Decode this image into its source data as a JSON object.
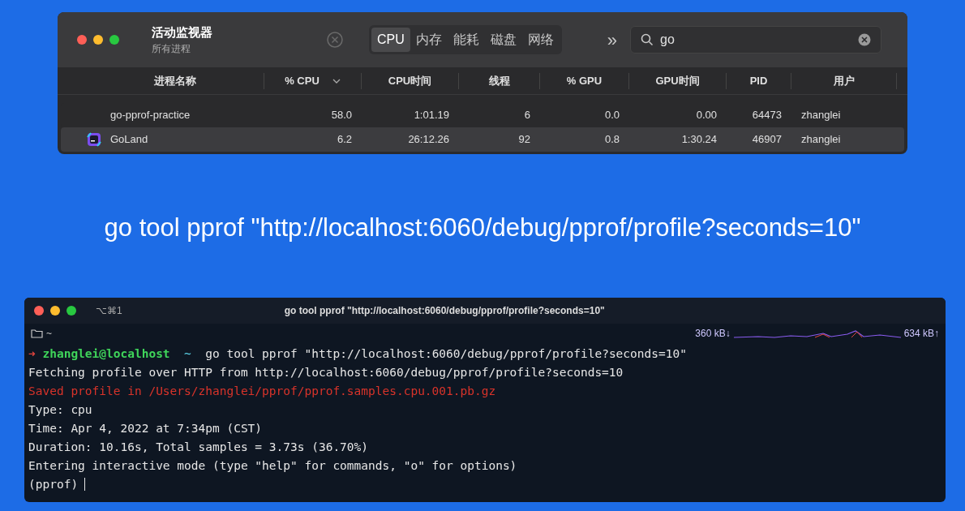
{
  "activity_monitor": {
    "title": "活动监视器",
    "subtitle": "所有进程",
    "tabs": [
      {
        "label": "CPU",
        "selected": true
      },
      {
        "label": "内存",
        "selected": false
      },
      {
        "label": "能耗",
        "selected": false
      },
      {
        "label": "磁盘",
        "selected": false
      },
      {
        "label": "网络",
        "selected": false
      }
    ],
    "more": "»",
    "search": {
      "value": "go"
    },
    "columns": [
      {
        "label": "进程名称",
        "sorted": false
      },
      {
        "label": "% CPU",
        "sorted": true
      },
      {
        "label": "CPU时间",
        "sorted": false
      },
      {
        "label": "线程",
        "sorted": false
      },
      {
        "label": "% GPU",
        "sorted": false
      },
      {
        "label": "GPU时间",
        "sorted": false
      },
      {
        "label": "PID",
        "sorted": false
      },
      {
        "label": "用户",
        "sorted": false
      }
    ],
    "rows": [
      {
        "selected": false,
        "has_icon": false,
        "cells": [
          "go-pprof-practice",
          "58.0",
          "1:01.19",
          "6",
          "0.0",
          "0.00",
          "64473",
          "zhanglei"
        ]
      },
      {
        "selected": true,
        "has_icon": true,
        "cells": [
          "GoLand",
          "6.2",
          "26:12.26",
          "92",
          "0.8",
          "1:30.24",
          "46907",
          "zhanglei"
        ]
      }
    ]
  },
  "command": "go tool pprof \"http://localhost:6060/debug/pprof/profile?seconds=10\"",
  "terminal": {
    "shortcut": "⌥⌘1",
    "title": "go tool pprof \"http://localhost:6060/debug/pprof/profile?seconds=10\"",
    "path": "~",
    "net_down": "360 kB↓",
    "net_up": "634 kB↑",
    "lines": [
      {
        "kind": "prompt",
        "marker": "➜",
        "user": "zhanglei@localhost",
        "dir": "~",
        "text": "go tool pprof \"http://localhost:6060/debug/pprof/profile?seconds=10\""
      },
      {
        "kind": "output",
        "text": "Fetching profile over HTTP from http://localhost:6060/debug/pprof/profile?seconds=10"
      },
      {
        "kind": "error",
        "text": "Saved profile in /Users/zhanglei/pprof/pprof.samples.cpu.001.pb.gz"
      },
      {
        "kind": "output",
        "text": "Type: cpu"
      },
      {
        "kind": "output",
        "text": "Time: Apr 4, 2022 at 7:34pm (CST)"
      },
      {
        "kind": "output",
        "text": "Duration: 10.16s, Total samples = 3.73s (36.70%)"
      },
      {
        "kind": "output",
        "text": "Entering interactive mode (type \"help\" for commands, \"o\" for options)"
      },
      {
        "kind": "input",
        "text": "(pprof)"
      }
    ]
  }
}
